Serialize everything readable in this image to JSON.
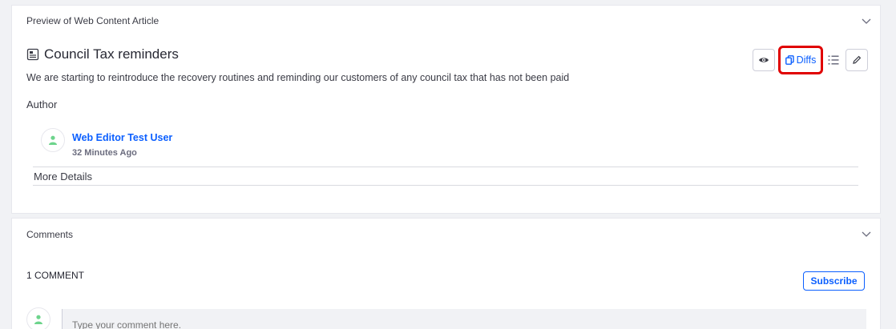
{
  "preview": {
    "header_title": "Preview of Web Content Article",
    "article_title": "Council Tax reminders",
    "article_description": "We are starting to reintroduce the recovery routines and reminding our customers of any council tax that has not been paid",
    "author_label": "Author",
    "author_name": "Web Editor Test User",
    "author_time": "32 Minutes Ago",
    "more_details": "More Details",
    "toolbar": {
      "diffs_label": "Diffs"
    }
  },
  "comments": {
    "header_title": "Comments",
    "count_label": "1 COMMENT",
    "subscribe_label": "Subscribe",
    "input_placeholder": "Type your comment here."
  },
  "colors": {
    "accent": "#0b5fff",
    "avatar_green": "#6dd48c",
    "highlight_red": "#e00000"
  }
}
